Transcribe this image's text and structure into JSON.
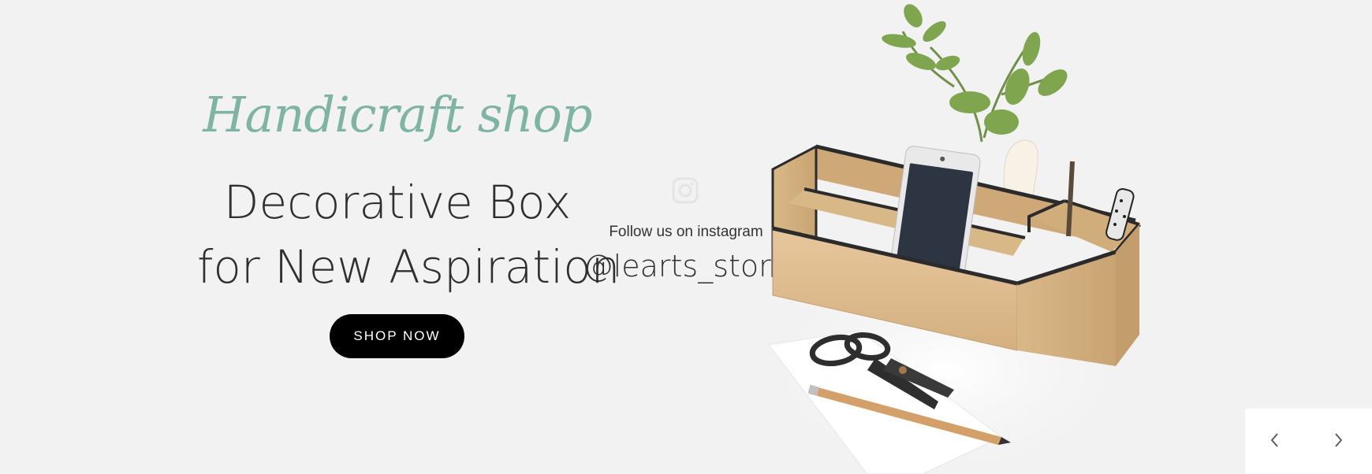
{
  "hero": {
    "script_title": "Handicraft shop",
    "headline_line1": "Decorative Box",
    "headline_line2": "for New Aspiration",
    "cta_label": "SHOP NOW"
  },
  "instagram": {
    "icon": "instagram-icon",
    "follow_text": "Follow us on instagram",
    "handle": "@learts_store"
  },
  "image": {
    "subject": "wooden desk organizer with phone, pens, plant, scissors and pencil"
  },
  "carousel": {
    "prev_icon": "chevron-left-icon",
    "next_icon": "chevron-right-icon"
  },
  "colors": {
    "background": "#f2f2f2",
    "script_accent": "#7fb4a4",
    "button_bg": "#000000",
    "text_dark": "#2f2f2f"
  }
}
